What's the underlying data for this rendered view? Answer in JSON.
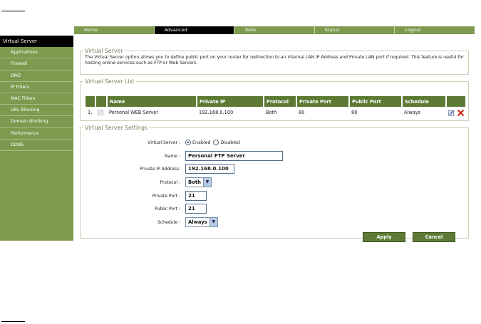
{
  "nav": {
    "tabs": [
      {
        "label": "Home"
      },
      {
        "label": "Advanced"
      },
      {
        "label": "Tools"
      },
      {
        "label": "Status"
      },
      {
        "label": "Logout"
      }
    ]
  },
  "sidebar": {
    "items": [
      {
        "label": "Virtual Server"
      },
      {
        "label": "Applications"
      },
      {
        "label": "Firewall"
      },
      {
        "label": "DMZ"
      },
      {
        "label": "IP Filters"
      },
      {
        "label": "MAC Filters"
      },
      {
        "label": "URL Blocking"
      },
      {
        "label": "Domain Blocking"
      },
      {
        "label": "Performance"
      },
      {
        "label": "DDNS"
      }
    ]
  },
  "info": {
    "title": "Virtual Server",
    "text": "The Virtual Server option allows you to define public port on your router for redirection to an internal LAN IP Address and Private LAN port if required. This feature is useful for hosting online services such as FTP or Web Servers."
  },
  "list": {
    "title": "Virtual Server List",
    "headers": [
      "Name",
      "Private IP",
      "Protocol",
      "Private Port",
      "Public Port",
      "Schedule"
    ],
    "rows": [
      {
        "index": "1.",
        "name": "Personal WEB Server",
        "private_ip": "192.168.0.100",
        "protocol": "Both",
        "private_port": "80",
        "public_port": "80",
        "schedule": "Always"
      }
    ]
  },
  "settings": {
    "title": "Virtual Server Settings",
    "virtual_server_label": "Virtual Server :",
    "enabled_label": "Enabled",
    "disabled_label": "Disabled",
    "name_label": "Name :",
    "name_value": "Personal FTP Server",
    "private_ip_label": "Private IP Address:",
    "private_ip_value": "192.168.0.100",
    "protocol_label": "Protocol :",
    "protocol_value": "Both",
    "private_port_label": "Private Port :",
    "private_port_value": "21",
    "public_port_label": "Public Port :",
    "public_port_value": "21",
    "schedule_label": "Schedule :",
    "schedule_value": "Always",
    "apply_label": "Apply",
    "cancel_label": "Cancel"
  },
  "colors": {
    "accent": "#7d9a4e",
    "header_dark": "#5d7a34",
    "active": "#000000",
    "delete_icon": "#d62a1e"
  }
}
